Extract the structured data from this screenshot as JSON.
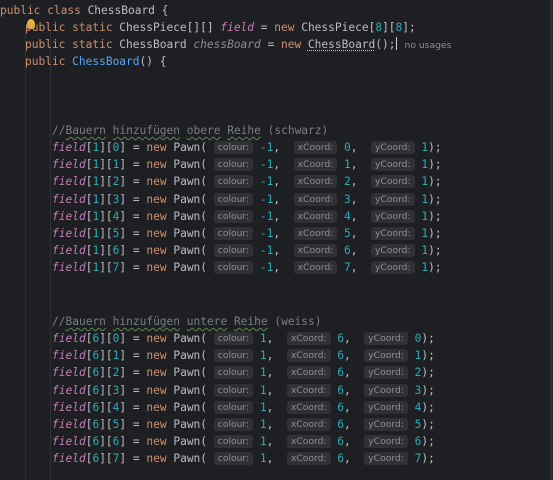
{
  "header": {
    "class_decl": {
      "kw": "public class ",
      "name": "ChessBoard",
      "brace": " {"
    },
    "field_decl": {
      "kw1": "public static ",
      "type": "ChessPiece[][] ",
      "name": "field",
      "eq": " = ",
      "kw2": "new ",
      "ctor": "ChessPiece",
      "dims_open": "[",
      "dim1": "8",
      "dims_mid": "][",
      "dim2": "8",
      "dims_close": "];"
    },
    "board_decl": {
      "kw1": "public static ",
      "type": "ChessBoard ",
      "name": "chessBoard",
      "eq": " = ",
      "kw2": "new ",
      "ctor": "ChessBoard",
      "paren": "();",
      "usages": "no usages"
    },
    "ctor_decl": {
      "kw": "public ",
      "name": "ChessBoard",
      "tail": "() {"
    }
  },
  "labels": {
    "colour": "colour:",
    "xcoord": "xCoord:",
    "ycoord": "yCoord:"
  },
  "section_black": {
    "comment": "//Bauern hinzufügen obere Reihe (schwarz)",
    "comment_parts": [
      "//",
      "Bauern",
      " ",
      "hinzufügen",
      " ",
      "obere",
      " ",
      "Reihe",
      " (schwarz)"
    ],
    "rows": [
      {
        "row": "1",
        "col": "0",
        "colour": "-1",
        "x": "0",
        "y": "1"
      },
      {
        "row": "1",
        "col": "1",
        "colour": "-1",
        "x": "1",
        "y": "1"
      },
      {
        "row": "1",
        "col": "2",
        "colour": "-1",
        "x": "2",
        "y": "1"
      },
      {
        "row": "1",
        "col": "3",
        "colour": "-1",
        "x": "3",
        "y": "1"
      },
      {
        "row": "1",
        "col": "4",
        "colour": "-1",
        "x": "4",
        "y": "1"
      },
      {
        "row": "1",
        "col": "5",
        "colour": "-1",
        "x": "5",
        "y": "1"
      },
      {
        "row": "1",
        "col": "6",
        "colour": "-1",
        "x": "6",
        "y": "1"
      },
      {
        "row": "1",
        "col": "7",
        "colour": "-1",
        "x": "7",
        "y": "1"
      }
    ]
  },
  "section_white": {
    "comment": "//Bauern hinzufügen untere Reihe (weiss)",
    "comment_parts": [
      "//",
      "Bauern",
      " ",
      "hinzufügen",
      " ",
      "untere",
      " ",
      "Reihe",
      " (weiss)"
    ],
    "rows": [
      {
        "row": "6",
        "col": "0",
        "colour": "1",
        "x": "6",
        "y": "0"
      },
      {
        "row": "6",
        "col": "1",
        "colour": "1",
        "x": "6",
        "y": "1"
      },
      {
        "row": "6",
        "col": "2",
        "colour": "1",
        "x": "6",
        "y": "2"
      },
      {
        "row": "6",
        "col": "3",
        "colour": "1",
        "x": "6",
        "y": "3"
      },
      {
        "row": "6",
        "col": "4",
        "colour": "1",
        "x": "6",
        "y": "4"
      },
      {
        "row": "6",
        "col": "5",
        "colour": "1",
        "x": "6",
        "y": "5"
      },
      {
        "row": "6",
        "col": "6",
        "colour": "1",
        "x": "6",
        "y": "6"
      },
      {
        "row": "6",
        "col": "7",
        "colour": "1",
        "x": "6",
        "y": "7"
      }
    ]
  },
  "code_tokens": {
    "field": "field",
    "eq": " = ",
    "new": "new ",
    "pawn": "Pawn( ",
    "end": ");"
  },
  "colors": {
    "background": "#1e1f22",
    "keyword": "#cf8e6d",
    "field": "#c77dbb",
    "number": "#2aacb8",
    "method": "#56a8f5",
    "comment": "#7a7e85",
    "hint_bg": "#2f3135"
  }
}
